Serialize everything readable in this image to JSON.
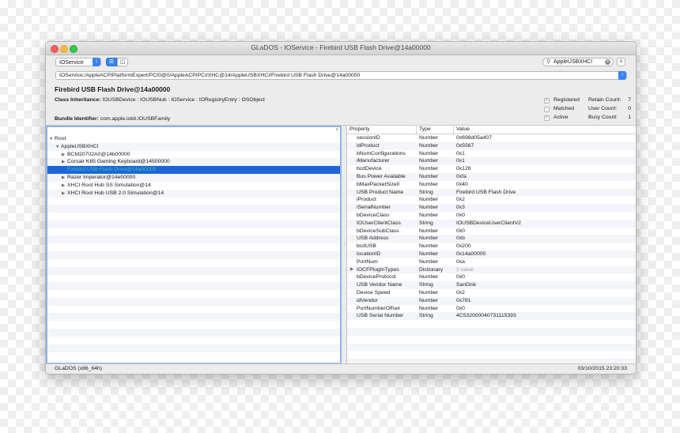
{
  "window": {
    "title": "GLaDOS - IOService - Firebird USB Flash Drive@14a00000"
  },
  "toolbar": {
    "plane_select": "IOService",
    "search_value": "AppleUSBXHCI",
    "path": "IOService:/AppleACPIPlatformExpert/PCI0@0/AppleACPIPCI/XHC@14/AppleUSBXHCI/Firebird USB Flash Drive@14a00000"
  },
  "info": {
    "device_title": "Firebird USB Flash Drive@14a00000",
    "class_inheritance_label": "Class Inheritance:",
    "class_inheritance_value": "IOUSBDevice : IOUSBNub : IOService : IORegistryEntry : OSObject",
    "bundle_label": "Bundle Identifier:",
    "bundle_value": "com.apple.iokit.IOUSBFamily",
    "flags": [
      {
        "label": "Registered",
        "checked": true,
        "count_label": "Retain Count:",
        "count_value": "7"
      },
      {
        "label": "Matched",
        "checked": false,
        "count_label": "User Count:",
        "count_value": "0"
      },
      {
        "label": "Active",
        "checked": true,
        "count_label": "Busy Count:",
        "count_value": "1"
      }
    ]
  },
  "tree": {
    "items": [
      {
        "label": "Root",
        "depth": 0,
        "expander": "open"
      },
      {
        "label": "AppleUSBXHCI",
        "depth": 1,
        "expander": "open"
      },
      {
        "label": "BCM20702A0@14b00000",
        "depth": 2,
        "expander": "closed"
      },
      {
        "label": "Corsair K65 Gaming Keyboard@14500000",
        "depth": 2,
        "expander": "closed"
      },
      {
        "label": "Firebird USB Flash Drive@14a00000",
        "depth": 2,
        "expander": "none",
        "selected": true
      },
      {
        "label": "Razer Imperator@14e00000",
        "depth": 2,
        "expander": "closed"
      },
      {
        "label": "XHCI Root Hub SS Simulation@14",
        "depth": 2,
        "expander": "closed"
      },
      {
        "label": "XHCI Root Hub USB 2.0 Simulation@14",
        "depth": 2,
        "expander": "closed"
      }
    ]
  },
  "table": {
    "headers": {
      "property": "Property",
      "type": "Type",
      "value": "Value"
    },
    "rows": [
      {
        "property": "sessionID",
        "type": "Number",
        "value": "0x698d05a407"
      },
      {
        "property": "idProduct",
        "type": "Number",
        "value": "0x5567"
      },
      {
        "property": "bNumConfigurations",
        "type": "Number",
        "value": "0x1"
      },
      {
        "property": "iManufacturer",
        "type": "Number",
        "value": "0x1"
      },
      {
        "property": "bcdDevice",
        "type": "Number",
        "value": "0x126"
      },
      {
        "property": "Bus Power Available",
        "type": "Number",
        "value": "0xfa"
      },
      {
        "property": "bMaxPacketSize0",
        "type": "Number",
        "value": "0x40"
      },
      {
        "property": "USB Product Name",
        "type": "String",
        "value": "Firebird USB Flash Drive"
      },
      {
        "property": "iProduct",
        "type": "Number",
        "value": "0x2"
      },
      {
        "property": "iSerialNumber",
        "type": "Number",
        "value": "0x3"
      },
      {
        "property": "bDeviceClass",
        "type": "Number",
        "value": "0x0"
      },
      {
        "property": "IOUserClientClass",
        "type": "String",
        "value": "IOUSBDeviceUserClientV2"
      },
      {
        "property": "bDeviceSubClass",
        "type": "Number",
        "value": "0x0"
      },
      {
        "property": "USB Address",
        "type": "Number",
        "value": "0xb"
      },
      {
        "property": "bcdUSB",
        "type": "Number",
        "value": "0x200"
      },
      {
        "property": "locationID",
        "type": "Number",
        "value": "0x14a00000"
      },
      {
        "property": "PortNum",
        "type": "Number",
        "value": "0xa"
      },
      {
        "property": "IOCFPlugInTypes",
        "type": "Dictionary",
        "value": "1 value",
        "expandable": true
      },
      {
        "property": "bDeviceProtocol",
        "type": "Number",
        "value": "0x0"
      },
      {
        "property": "USB Vendor Name",
        "type": "String",
        "value": "SanDisk"
      },
      {
        "property": "Device Speed",
        "type": "Number",
        "value": "0x2"
      },
      {
        "property": "idVendor",
        "type": "Number",
        "value": "0x781"
      },
      {
        "property": "PortNumberOffset",
        "type": "Number",
        "value": "0x0"
      },
      {
        "property": "USB Serial Number",
        "type": "String",
        "value": "4C532000040731115393"
      }
    ]
  },
  "status": {
    "left": "GLaDOS (x86_64h)",
    "right": "03/10/2015 23:20:33"
  },
  "colors": {
    "selection": "#1e66d8",
    "accent": "#3a84f2",
    "close": "#fc605b",
    "minimize": "#fdbc40",
    "maximize": "#34c84a"
  }
}
